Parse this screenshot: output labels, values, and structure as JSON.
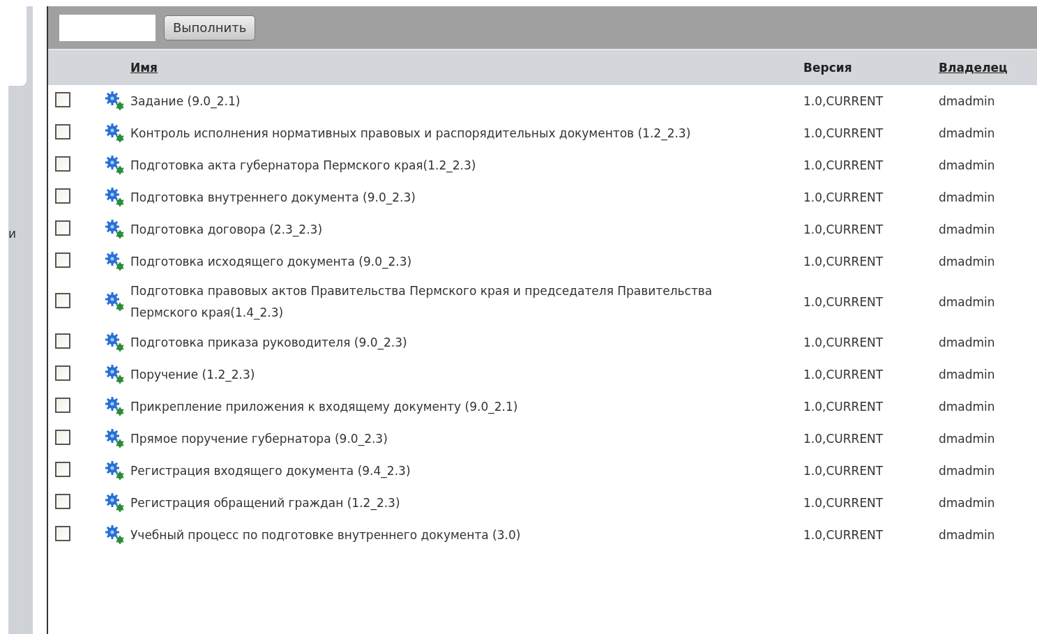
{
  "sidebar": {
    "label": "и"
  },
  "toolbar": {
    "button": "Выполнить"
  },
  "table": {
    "columns": [
      {
        "label": "Имя",
        "sortable": true
      },
      {
        "label": "Версия",
        "sortable": false
      },
      {
        "label": "Владелец",
        "sortable": true
      }
    ],
    "rows": [
      {
        "checked": false,
        "name": "Задание (9.0_2.1)",
        "version": "1.0,CURRENT",
        "owner": "dmadmin"
      },
      {
        "checked": false,
        "name": "Контроль исполнения нормативных правовых и распорядительных документов (1.2_2.3)",
        "version": "1.0,CURRENT",
        "owner": "dmadmin"
      },
      {
        "checked": false,
        "name": "Подготовка акта губернатора Пермского края(1.2_2.3)",
        "version": "1.0,CURRENT",
        "owner": "dmadmin"
      },
      {
        "checked": false,
        "name": "Подготовка внутреннего документа (9.0_2.3)",
        "version": "1.0,CURRENT",
        "owner": "dmadmin"
      },
      {
        "checked": false,
        "name": "Подготовка договора (2.3_2.3)",
        "version": "1.0,CURRENT",
        "owner": "dmadmin"
      },
      {
        "checked": false,
        "name": "Подготовка исходящего документа (9.0_2.3)",
        "version": "1.0,CURRENT",
        "owner": "dmadmin"
      },
      {
        "checked": false,
        "name": "Подготовка правовых актов Правительства Пермского края и председателя Правительства Пермского края(1.4_2.3)",
        "version": "1.0,CURRENT",
        "owner": "dmadmin"
      },
      {
        "checked": false,
        "name": "Подготовка приказа руководителя (9.0_2.3)",
        "version": "1.0,CURRENT",
        "owner": "dmadmin"
      },
      {
        "checked": false,
        "name": "Поручение (1.2_2.3)",
        "version": "1.0,CURRENT",
        "owner": "dmadmin"
      },
      {
        "checked": false,
        "name": "Прикрепление приложения к входящему документу (9.0_2.1)",
        "version": "1.0,CURRENT",
        "owner": "dmadmin"
      },
      {
        "checked": false,
        "name": "Прямое поручение губернатора (9.0_2.3)",
        "version": "1.0,CURRENT",
        "owner": "dmadmin"
      },
      {
        "checked": false,
        "name": "Регистрация входящего документа (9.4_2.3)",
        "version": "1.0,CURRENT",
        "owner": "dmadmin"
      },
      {
        "checked": false,
        "name": "Регистрация обращений граждан (1.2_2.3)",
        "version": "1.0,CURRENT",
        "owner": "dmadmin"
      },
      {
        "checked": false,
        "name": "Учебный процесс по подготовке внутреннего документа (3.0)",
        "version": "1.0,CURRENT",
        "owner": "dmadmin"
      }
    ]
  }
}
